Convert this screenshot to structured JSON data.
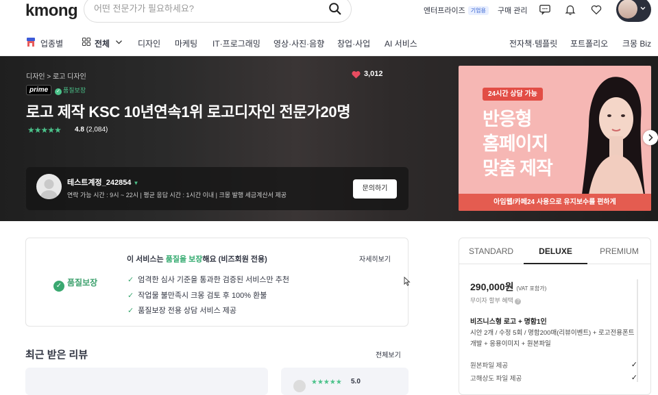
{
  "header": {
    "logo": "kmong",
    "search_placeholder": "어떤 전문가가 필요하세요?",
    "enterprise": "엔터프라이즈",
    "enterprise_badge": "기업용",
    "purchase": "구매 관리"
  },
  "nav": {
    "category": "업종별",
    "all": "전체",
    "items": [
      "디자인",
      "마케팅",
      "IT·프로그래밍",
      "영상·사진·음향",
      "창업·사업",
      "AI 서비스"
    ],
    "right": [
      "전자책·템플릿",
      "포트폴리오",
      "크몽 Biz"
    ]
  },
  "hero": {
    "breadcrumb": "디자인 > 로고 디자인",
    "likes": "3,012",
    "prime": "prime",
    "quality_badge": "품질보장",
    "title": "로고 제작 KSC 10년연속1위 로고디자인 전문가20명",
    "rating": "4.8",
    "reviews": "(2,084)",
    "rating_value": 4.8,
    "seller": {
      "name": "테스트계정_242854",
      "info": "연락 가능 시간 : 9시 ~ 22시   |   평균 응답 시간 : 1시간 이내   |   크몽 발행 세금계산서 제공",
      "button": "문의하기"
    },
    "ad": {
      "pill": "24시간 상담 가능",
      "lines": [
        "반응형",
        "홈페이지",
        "맞춤 제작"
      ],
      "bottom": "아임웹/카페24 사용으로 유지보수를 편하게"
    }
  },
  "quality": {
    "label": "품질보장",
    "head_pre": "이 서비스는 ",
    "head_hl": "품질을 보장",
    "head_post": "해요 (비즈회원 전용)",
    "more": "자세히보기",
    "items": [
      "엄격한 심사 기준을 통과한 검증된 서비스만 추천",
      "작업물 불만족시 크몽 검토 후 100% 환불",
      "품질보장 전용 상담 서비스 제공"
    ]
  },
  "reviews": {
    "title": "최근 받은 리뷰",
    "more": "전체보기",
    "score": "5.0"
  },
  "package": {
    "tabs": [
      "STANDARD",
      "DELUXE",
      "PREMIUM"
    ],
    "active_tab": "DELUXE",
    "price": "290,000원",
    "vat": "(VAT 포함가)",
    "installment": "무이자 할부 혜택",
    "name": "비즈니스형 로고 + 명함1인",
    "desc": "시안 2개 / 수정 5회 / 명함200매(리뷰이벤트) + 로고전용폰트개발 + 응용이미지 + 원본파일",
    "features": [
      "원본파일 제공",
      "고해상도 파일 제공"
    ]
  },
  "colors": {
    "accent": "#2ea86b",
    "star": "#4bc28a",
    "heart": "#e84c60",
    "ad_bg": "#f6b7b4"
  }
}
